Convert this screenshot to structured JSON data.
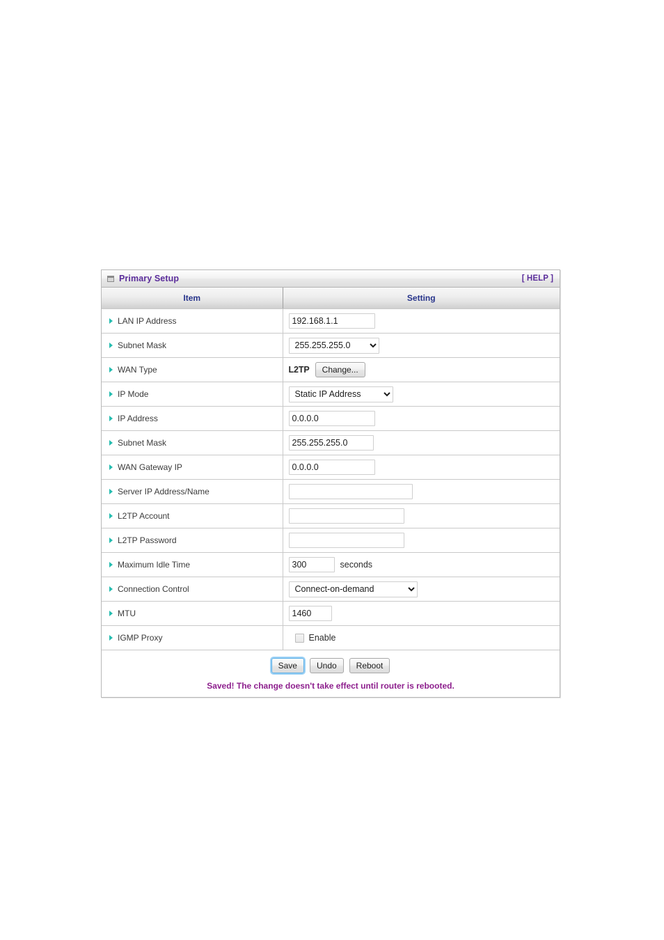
{
  "panel": {
    "title": "Primary Setup",
    "window_icon": "window-restore-icon",
    "help_label": "[ HELP ]",
    "title_color": "#5b2d9b"
  },
  "table": {
    "headers": {
      "item": "Item",
      "setting": "Setting"
    },
    "header_text_color": "#27348b",
    "bullet_color": "#27bdb0",
    "rows": [
      {
        "name": "lan-ip-address",
        "label": "LAN IP Address",
        "control": "text",
        "value": "192.168.1.1",
        "placeholder": "",
        "width_class": "w-ip"
      },
      {
        "name": "lan-subnet-mask",
        "label": "Subnet Mask",
        "control": "select",
        "value": "255.255.255.0",
        "options": [
          "255.255.255.0"
        ],
        "width_class": "sel-mask"
      },
      {
        "name": "wan-type",
        "label": "WAN Type",
        "control": "wantype",
        "value": "L2TP",
        "button_label": "Change..."
      },
      {
        "name": "ip-mode",
        "label": "IP Mode",
        "control": "select",
        "value": "Static IP Address",
        "options": [
          "Static IP Address"
        ],
        "width_class": "sel-mode"
      },
      {
        "name": "ip-address",
        "label": "IP Address",
        "control": "text",
        "value": "0.0.0.0",
        "placeholder": "",
        "width_class": "w-ip"
      },
      {
        "name": "wan-subnet-mask",
        "label": "Subnet Mask",
        "control": "text",
        "value": "255.255.255.0",
        "placeholder": "",
        "width_class": "w-mask"
      },
      {
        "name": "wan-gateway-ip",
        "label": "WAN Gateway IP",
        "control": "text",
        "value": "0.0.0.0",
        "placeholder": "",
        "width_class": "w-ip"
      },
      {
        "name": "server-ip-address-name",
        "label": "Server IP Address/Name",
        "control": "text",
        "value": "",
        "placeholder": "",
        "width_class": "w-blank-lg"
      },
      {
        "name": "l2tp-account",
        "label": "L2TP Account",
        "control": "text",
        "value": "",
        "placeholder": "",
        "width_class": "w-blank-md"
      },
      {
        "name": "l2tp-password",
        "label": "L2TP Password",
        "control": "text",
        "value": "",
        "placeholder": "",
        "width_class": "w-blank-md"
      },
      {
        "name": "maximum-idle-time",
        "label": "Maximum Idle Time",
        "control": "text-unit",
        "value": "300",
        "placeholder": "",
        "unit": "seconds",
        "width_class": "w-num"
      },
      {
        "name": "connection-control",
        "label": "Connection Control",
        "control": "select",
        "value": "Connect-on-demand",
        "options": [
          "Connect-on-demand"
        ],
        "width_class": "sel-conn"
      },
      {
        "name": "mtu",
        "label": "MTU",
        "control": "text",
        "value": "1460",
        "placeholder": "",
        "width_class": "w-mtu"
      },
      {
        "name": "igmp-proxy",
        "label": "IGMP Proxy",
        "control": "checkbox",
        "checkbox_label": "Enable",
        "checked": false
      }
    ]
  },
  "footer": {
    "save_label": "Save",
    "undo_label": "Undo",
    "reboot_label": "Reboot",
    "status_message": "Saved! The change doesn't take effect until router is rebooted.",
    "status_color": "#8d1f8d"
  }
}
